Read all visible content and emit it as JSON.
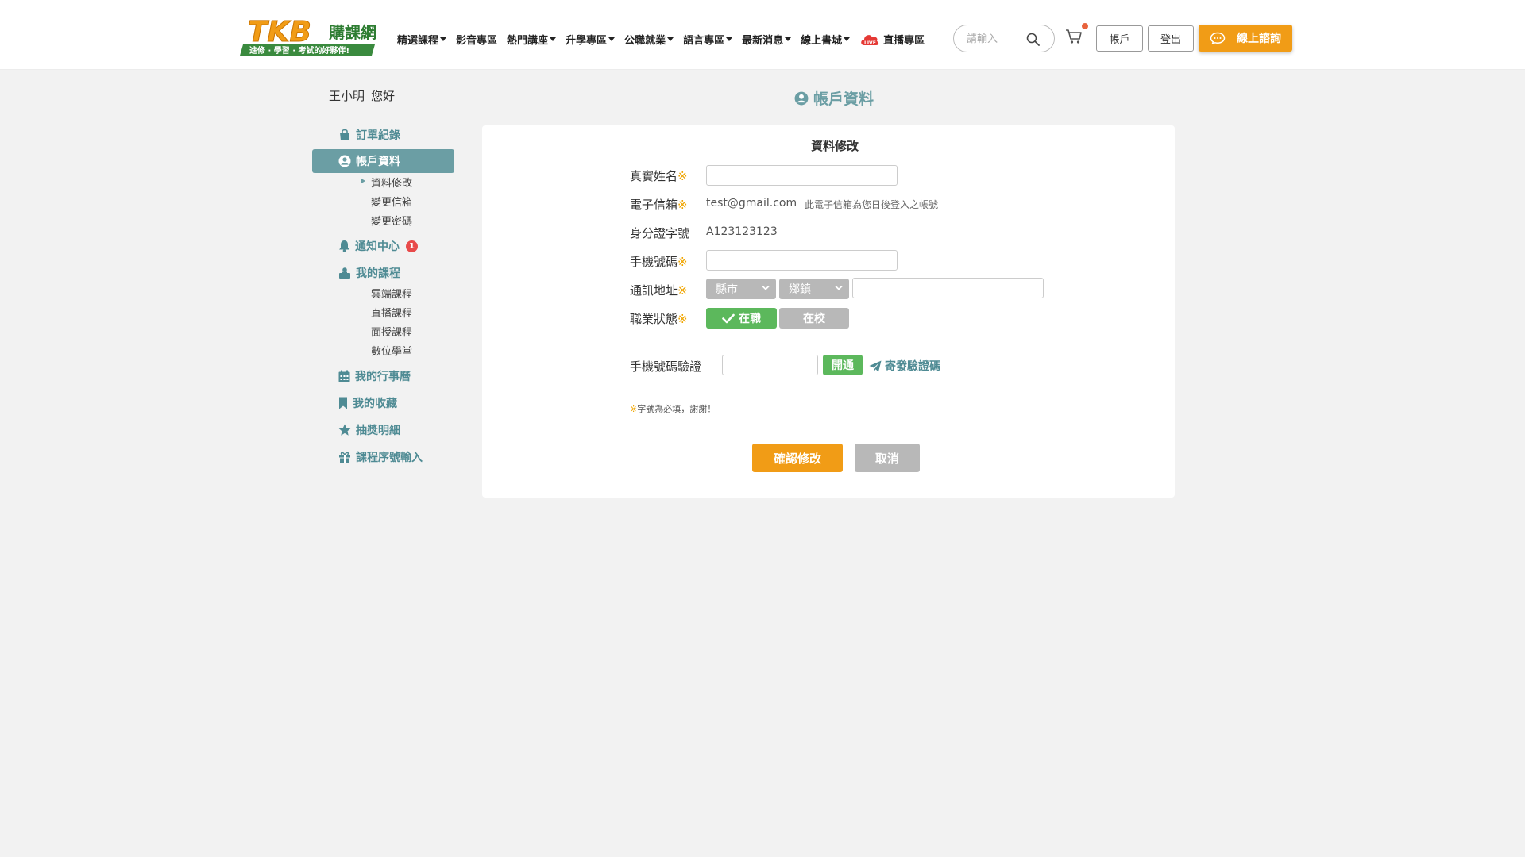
{
  "header": {
    "logo": {
      "text": "TKB",
      "sub_text": "購課網",
      "slogan": "進修 · 學習 · 考試的好夥伴!"
    },
    "nav": [
      {
        "label": "精選課程",
        "dropdown": true
      },
      {
        "label": "影音專區",
        "dropdown": false
      },
      {
        "label": "熱門講座",
        "dropdown": true
      },
      {
        "label": "升學專區",
        "dropdown": true
      },
      {
        "label": "公職就業",
        "dropdown": true
      },
      {
        "label": "語言專區",
        "dropdown": true
      },
      {
        "label": "最新消息",
        "dropdown": true
      },
      {
        "label": "線上書城",
        "dropdown": true
      },
      {
        "label": "直播專區",
        "dropdown": false,
        "icon": "live-cloud-icon",
        "icon_text": "LIVE"
      }
    ],
    "search_placeholder": "請輸入",
    "account_label": "帳戶",
    "logout_label": "登出",
    "consult_label": "線上諮詢"
  },
  "sidebar": {
    "user_name": "王小明",
    "greeting": "您好",
    "items": [
      {
        "label": "訂單紀錄",
        "icon": "shopping-bag-icon"
      },
      {
        "label": "帳戶資料",
        "icon": "user-circle-icon",
        "active": true
      },
      {
        "label": "資料修改",
        "sub": true,
        "current": true
      },
      {
        "label": "變更信箱",
        "sub": true
      },
      {
        "label": "變更密碼",
        "sub": true
      },
      {
        "label": "通知中心",
        "icon": "bell-icon",
        "badge": "1"
      },
      {
        "label": "我的課程",
        "icon": "courses-icon"
      },
      {
        "label": "雲端課程",
        "sub": true
      },
      {
        "label": "直播課程",
        "sub": true
      },
      {
        "label": "面授課程",
        "sub": true
      },
      {
        "label": "數位學堂",
        "sub": true
      },
      {
        "label": "我的行事曆",
        "icon": "calendar-icon"
      },
      {
        "label": "我的收藏",
        "icon": "bookmark-icon"
      },
      {
        "label": "抽獎明細",
        "icon": "star-icon"
      },
      {
        "label": "課程序號輸入",
        "icon": "gift-icon"
      }
    ]
  },
  "main": {
    "page_title": "帳戶資料",
    "section_title": "資料修改",
    "required_mark": "※",
    "fields": {
      "name_label": "真實姓名",
      "name_value": "",
      "email_label": "電子信箱",
      "email_value": "test@gmail.com",
      "email_note": "此電子信箱為您日後登入之帳號",
      "id_label": "身分證字號",
      "id_value": "A123123123",
      "phone_label": "手機號碼",
      "phone_value": "",
      "address_label": "通訊地址",
      "city_select": "縣市",
      "town_select": "鄉鎮",
      "address_value": "",
      "job_label": "職業狀態",
      "job_options": [
        "在職",
        "在校"
      ],
      "job_selected": "在職"
    },
    "verify": {
      "label": "手機號碼驗證",
      "code_value": "",
      "open_label": "開通",
      "send_label": "寄發驗證碼"
    },
    "required_note": "字號為必填，謝謝！",
    "confirm_label": "確認修改",
    "cancel_label": "取消"
  },
  "colors": {
    "brand_orange": "#f19c16",
    "teal": "#6b9ea4",
    "teal_text": "#4f8b94",
    "green": "#5cb85c",
    "gray_button": "#b8b8b8",
    "badge_red": "#e84a4a",
    "required": "#f0a500",
    "background": "#f2f2f2"
  }
}
